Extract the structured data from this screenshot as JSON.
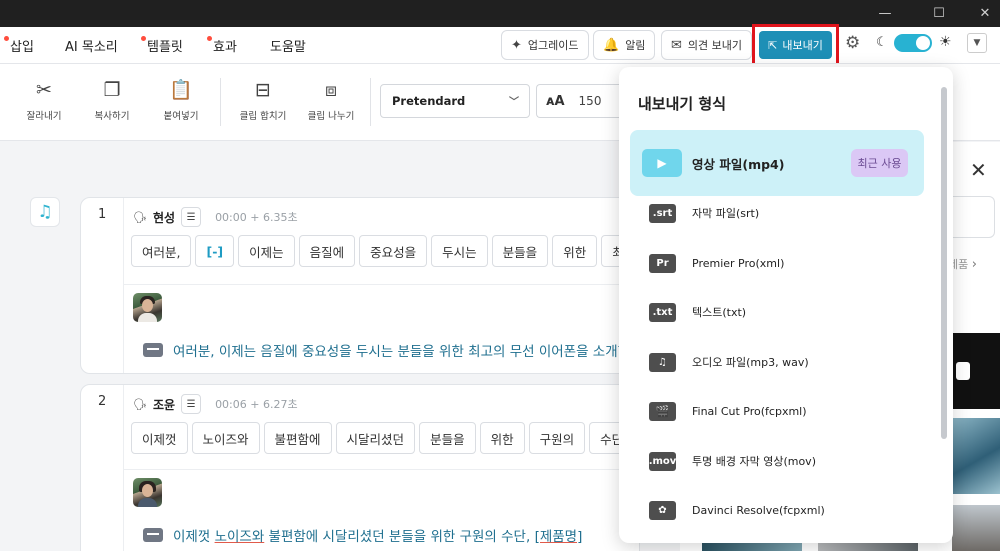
{
  "window": {
    "minimize_icon": "minimize-icon",
    "maximize_icon": "maximize-icon",
    "close_icon": "close-icon"
  },
  "menu": {
    "items": [
      {
        "label": "삽입",
        "has_dot": true
      },
      {
        "label": "AI 목소리",
        "has_dot": false
      },
      {
        "label": "템플릿",
        "has_dot": true
      },
      {
        "label": "효과",
        "has_dot": true
      },
      {
        "label": "도움말",
        "has_dot": false
      }
    ],
    "upgrade": "업그레이드",
    "alerts": "알림",
    "feedback": "의견 보내기",
    "export": "내보내기"
  },
  "toolbar": {
    "tools": [
      "잘라내기",
      "복사하기",
      "붙여넣기",
      "클립 합치기",
      "클립 나누기"
    ],
    "font": "Pretendard",
    "size": "150"
  },
  "clips": [
    {
      "num": "1",
      "speaker": "현성",
      "time": "00:00 + 6.35초",
      "words": [
        "여러분,",
        "[-]",
        "이제는",
        "음질에",
        "중요성을",
        "두시는",
        "분들을",
        "위한",
        "최고"
      ],
      "subtitle": "여러분, 이제는 음질에 중요성을 두시는 분들을 위한 최고의 무선 이어폰을 소개합"
    },
    {
      "num": "2",
      "speaker": "조윤",
      "time": "00:06 + 6.27초",
      "words": [
        "이제껏",
        "노이즈와",
        "불편함에",
        "시달리셨던",
        "분들을",
        "위한",
        "구원의",
        "수단,"
      ],
      "subtitle_parts": [
        "이제껏 ",
        "노이즈와",
        " 불편함에 시달리셨던 분들을 위한 구원의 수단, ",
        "[제품명]"
      ]
    }
  ],
  "right_panel": {
    "text": "제품"
  },
  "export_menu": {
    "title": "내보내기 형식",
    "items": [
      {
        "icon": "▶",
        "label": "영상 파일(mp4)",
        "badge": "최근 사용"
      },
      {
        "icon": ".srt",
        "label": "자막 파일(srt)"
      },
      {
        "icon": "Pr",
        "label": "Premier Pro(xml)"
      },
      {
        "icon": ".txt",
        "label": "텍스트(txt)"
      },
      {
        "icon": "♫",
        "label": "오디오 파일(mp3, wav)"
      },
      {
        "icon": "🎬",
        "label": "Final Cut Pro(fcpxml)"
      },
      {
        "icon": ".mov",
        "label": "투명 배경 자막 영상(mov)"
      },
      {
        "icon": "✿",
        "label": "Davinci Resolve(fcpxml)"
      }
    ]
  }
}
